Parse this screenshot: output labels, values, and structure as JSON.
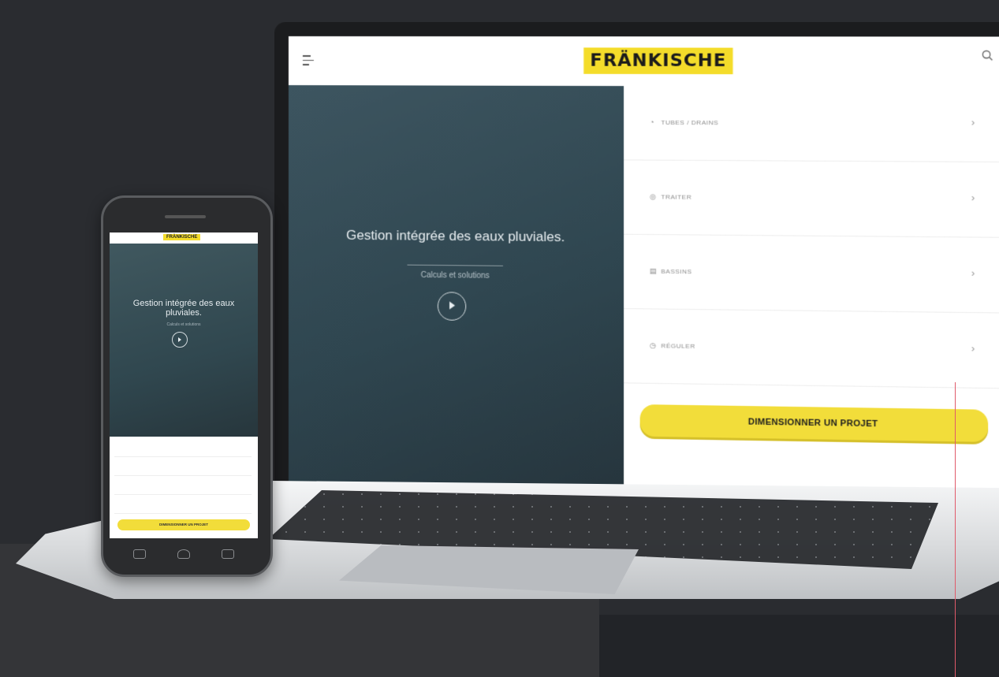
{
  "laptop": {
    "logo": "FRÄNKISCHE",
    "hero": {
      "title": "Gestion intégrée des eaux pluviales.",
      "subtitle": "Calculs et solutions"
    },
    "menu": [
      {
        "icon": "tube-icon",
        "label": "TUBES / DRAINS"
      },
      {
        "icon": "treat-icon",
        "label": "TRAITER"
      },
      {
        "icon": "basin-icon",
        "label": "BASSINS"
      },
      {
        "icon": "regulate-icon",
        "label": "RÉGULER"
      }
    ],
    "cta_label": "DIMENSIONNER UN PROJET"
  },
  "phone": {
    "logo": "FRÄNKISCHE",
    "hero": {
      "title": "Gestion intégrée des eaux pluviales.",
      "subtitle": "Calculs et solutions"
    },
    "cta_label": "DIMENSIONNER UN PROJET"
  },
  "colors": {
    "brand_yellow": "#f4dc2a",
    "hero_slate": "#2f4650",
    "background": "#2a2c30"
  }
}
